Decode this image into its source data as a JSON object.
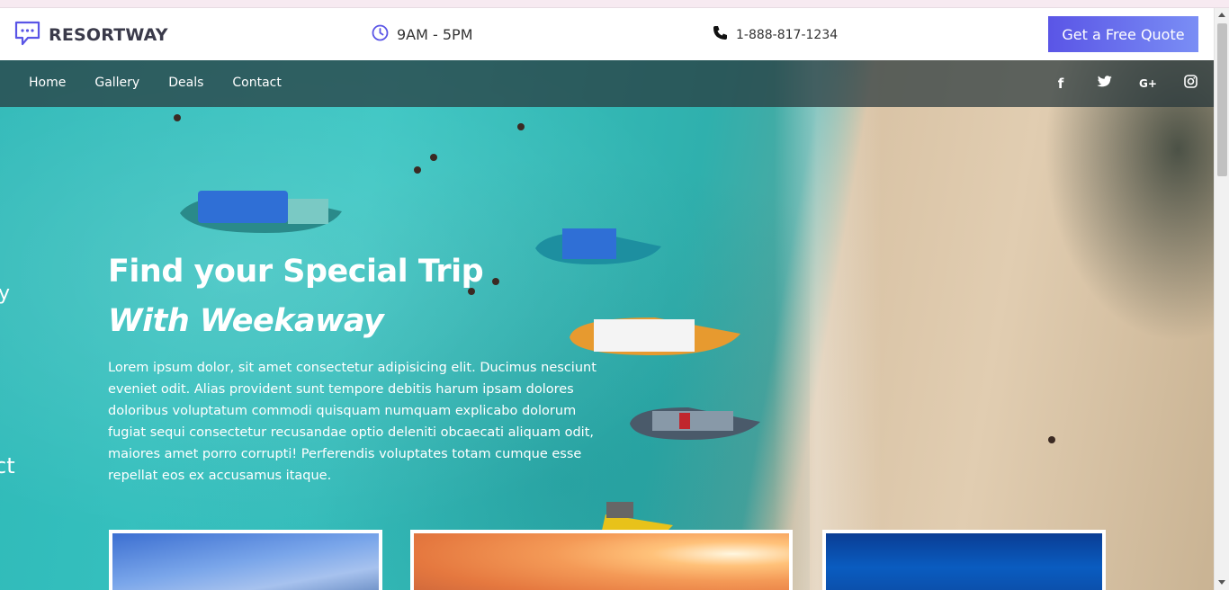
{
  "header": {
    "logo_text": "RESORTWAY",
    "hours": "9AM - 5PM",
    "phone": "1-888-817-1234",
    "quote_button": "Get a Free Quote"
  },
  "nav": {
    "links": [
      "Home",
      "Gallery",
      "Deals",
      "Contact"
    ],
    "social": [
      "f",
      "t",
      "G+",
      "ig"
    ]
  },
  "hero": {
    "title": "Find your Special Trip",
    "subtitle": "With Weekaway",
    "text": "Lorem ipsum dolor, sit amet consectetur adipisicing elit. Ducimus nesciunt eveniet odit. Alias provident sunt tempore debitis harum ipsam dolores doloribus voluptatum commodi quisquam numquam explicabo dolorum fugiat sequi consectetur recusandae optio deleniti obcaecati aliquam odit, maiores amet porro corrupti! Perferendis voluptates totam cumque esse repellat eos ex accusamus itaque.",
    "side_fragment_1": "y",
    "side_fragment_2": "ct"
  },
  "colors": {
    "accent": "#5a55e6",
    "accent_light": "#7a8ef5",
    "nav_bg": "#28373c",
    "water": "#39c5c2",
    "sand": "#e1cdb1"
  },
  "icons": {
    "logo": "chat-bubble-icon",
    "hours": "clock-icon",
    "phone": "phone-icon",
    "social": [
      "facebook-icon",
      "twitter-icon",
      "google-plus-icon",
      "instagram-icon"
    ]
  }
}
